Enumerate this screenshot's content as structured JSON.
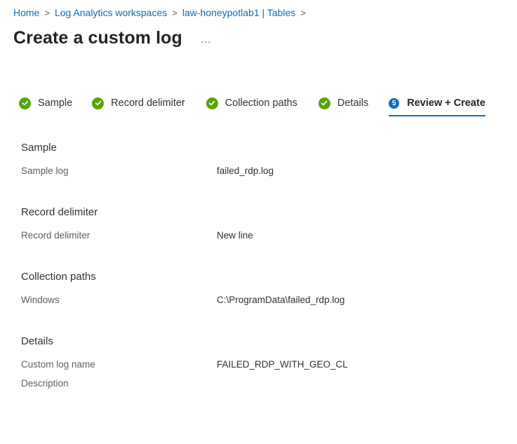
{
  "breadcrumb": {
    "items": [
      "Home",
      "Log Analytics workspaces",
      "law-honeypotlab1 | Tables"
    ],
    "separator": ">"
  },
  "page": {
    "title": "Create a custom log",
    "more_label": "..."
  },
  "tabs": [
    {
      "label": "Sample",
      "status": "complete"
    },
    {
      "label": "Record delimiter",
      "status": "complete"
    },
    {
      "label": "Collection paths",
      "status": "complete"
    },
    {
      "label": "Details",
      "status": "complete"
    },
    {
      "label": "Review + Create",
      "status": "active",
      "step": "5"
    }
  ],
  "review": {
    "sample": {
      "heading": "Sample",
      "label": "Sample log",
      "value": "failed_rdp.log"
    },
    "record_delimiter": {
      "heading": "Record delimiter",
      "label": "Record delimiter",
      "value": "New line"
    },
    "collection_paths": {
      "heading": "Collection paths",
      "label": "Windows",
      "value": "C:\\ProgramData\\failed_rdp.log"
    },
    "details": {
      "heading": "Details",
      "name_label": "Custom log name",
      "name_value": "FAILED_RDP_WITH_GEO_CL",
      "description_label": "Description",
      "description_value": ""
    }
  },
  "colors": {
    "link": "#0f6cbd",
    "complete": "#57a300",
    "active_underline": "#0f6cbd"
  }
}
